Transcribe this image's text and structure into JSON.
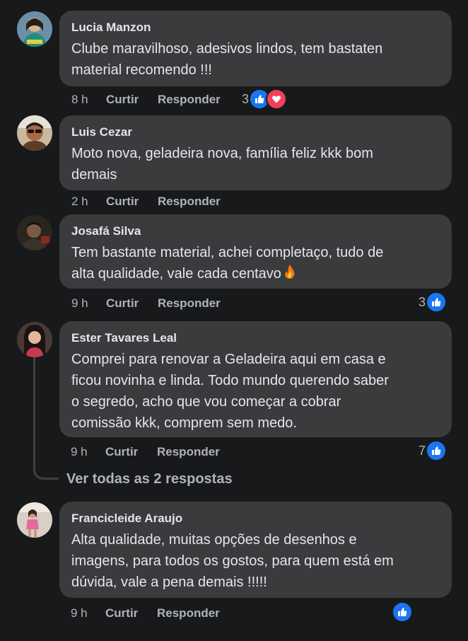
{
  "comments": [
    {
      "author": "Lucia Manzon",
      "text": "Clube maravilhoso, adesivos lindos, tem bastaten\nmaterial recomendo !!!",
      "time": "8 h",
      "like_label": "Curtir",
      "reply_label": "Responder",
      "reaction_count": "3",
      "reactions": [
        "like-icon",
        "love-icon"
      ]
    },
    {
      "author": "Luis Cezar",
      "text": "Moto nova, geladeira nova, família feliz kkk bom\ndemais",
      "time": "2 h",
      "like_label": "Curtir",
      "reply_label": "Responder",
      "reaction_count": "",
      "reactions": []
    },
    {
      "author": "Josafá Silva",
      "text": "Tem bastante material, achei completaço, tudo de\nalta qualidade, vale cada centavo",
      "emoji": "fire-emoji",
      "time": "9 h",
      "like_label": "Curtir",
      "reply_label": "Responder",
      "reaction_count": "3",
      "reactions": [
        "like-icon"
      ]
    },
    {
      "author": "Ester Tavares Leal",
      "text": "Comprei para renovar a Geladeira aqui em casa e\nficou novinha e linda. Todo mundo querendo saber\no segredo, acho que vou começar a cobrar\ncomissão kkk, comprem sem medo.",
      "time": "9 h",
      "like_label": "Curtir",
      "reply_label": "Responder",
      "reaction_count": "7",
      "reactions": [
        "like-icon"
      ]
    },
    {
      "author": "Francicleide Araujo",
      "text": "Alta qualidade, muitas opções de desenhos e\nimagens, para todos os gostos, para quem está em\ndúvida, vale a pena demais !!!!!",
      "time": "9 h",
      "like_label": "Curtir",
      "reply_label": "Responder",
      "reaction_count": "",
      "reactions": [
        "like-icon"
      ]
    }
  ],
  "view_replies": "Ver todas as 2 respostas",
  "colors": {
    "background": "#18191a",
    "bubble": "#3a3b3c",
    "text": "#e4e6eb",
    "secondary_text": "#b0b3b8",
    "like_blue": "#1877f2",
    "love_red": "#f33e58"
  }
}
